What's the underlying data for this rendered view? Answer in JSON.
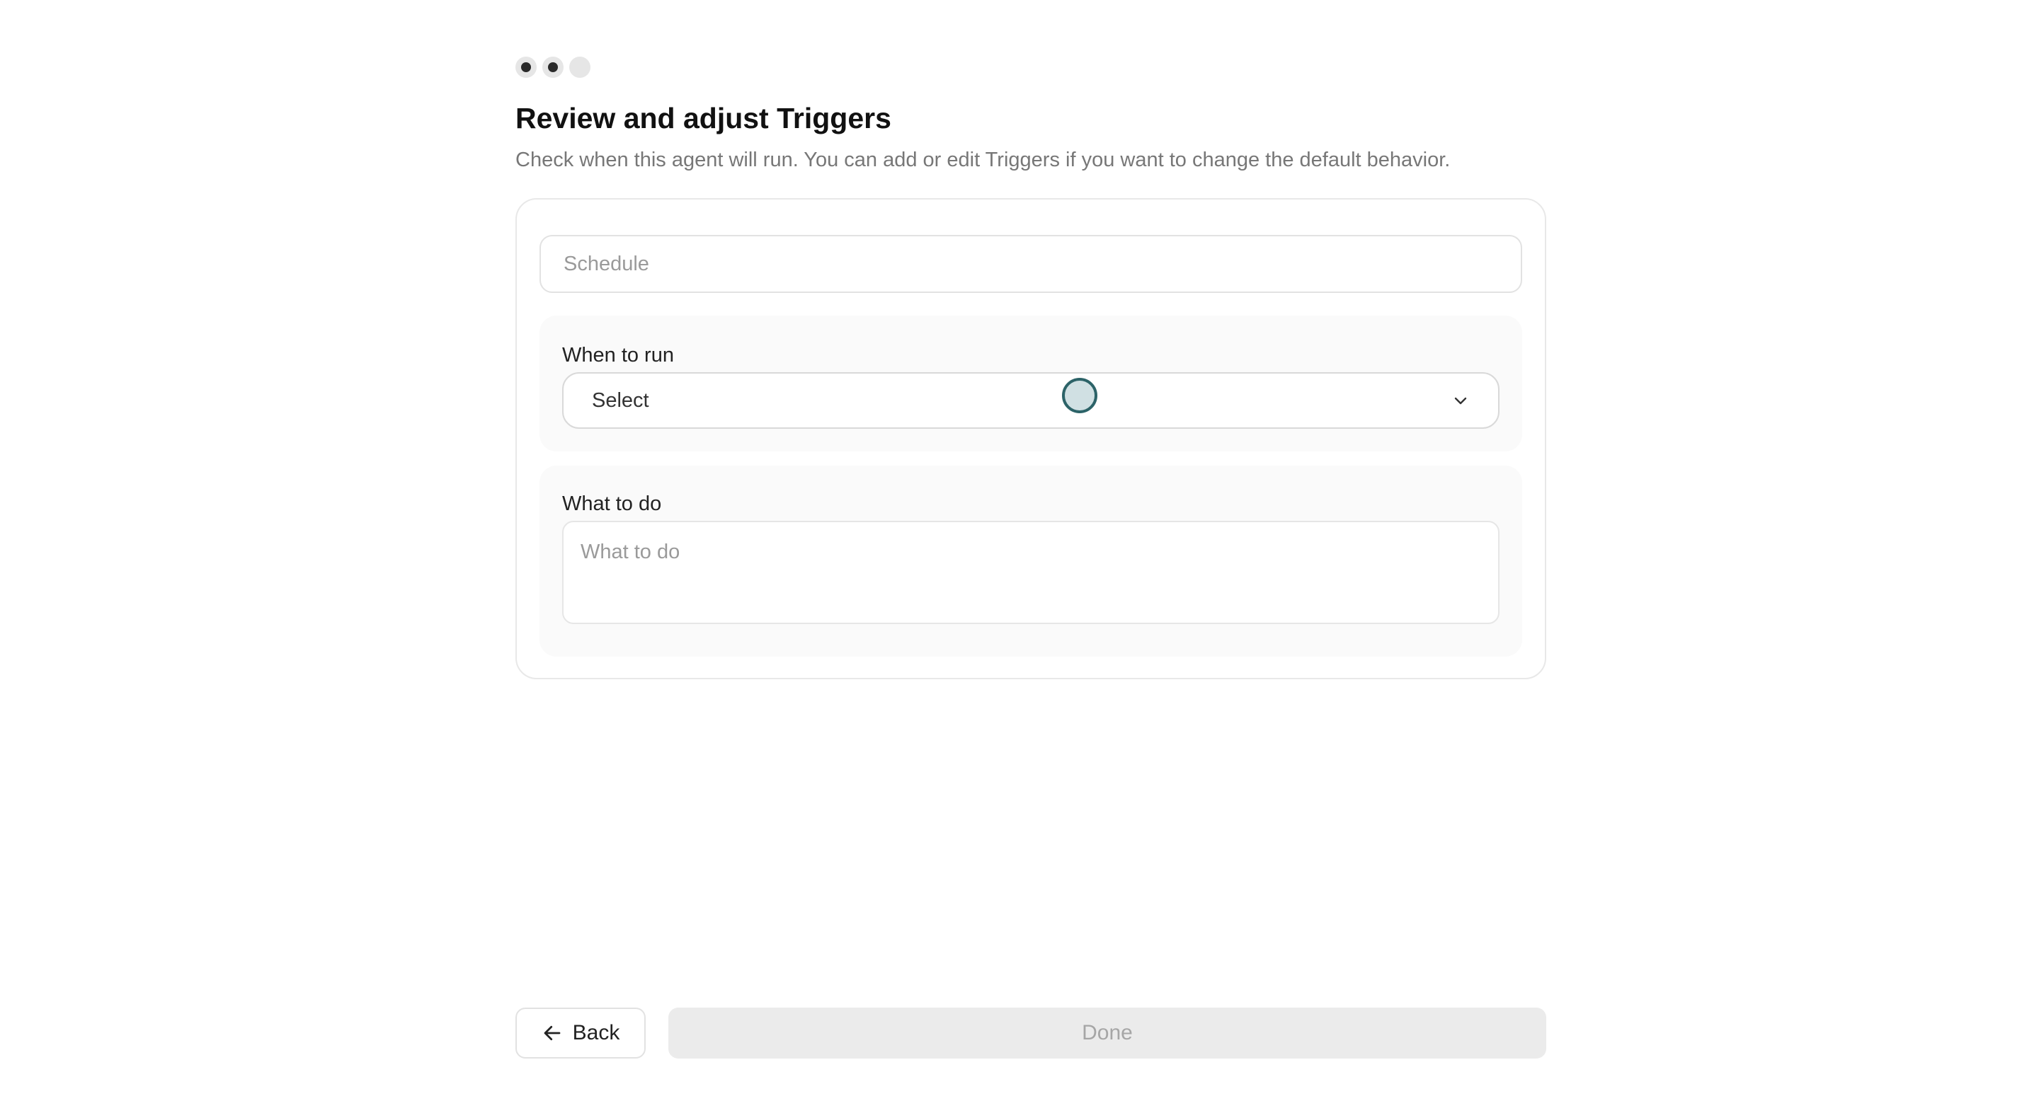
{
  "stepper": {
    "total_steps": 3,
    "current_step": 3
  },
  "header": {
    "title": "Review and adjust Triggers",
    "subtitle": "Check when this agent will run. You can add or edit Triggers if you want to change the default behavior."
  },
  "trigger": {
    "name_placeholder": "Schedule",
    "name_value": "",
    "when_label": "When to run",
    "when_value": "Select",
    "what_label": "What to do",
    "what_placeholder": "What to do",
    "what_value": ""
  },
  "footer": {
    "back_label": "Back",
    "done_label": "Done",
    "done_disabled": true
  },
  "icons": {
    "back": "arrow-left-icon",
    "dropdown": "chevron-down-icon"
  },
  "colors": {
    "accent_cursor": "#2c6368",
    "disabled_button_bg": "#ebebeb",
    "disabled_button_text": "#a6a6a6"
  }
}
